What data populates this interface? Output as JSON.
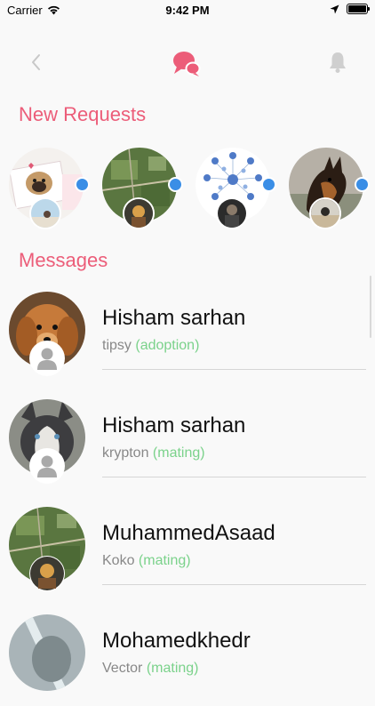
{
  "status_bar": {
    "carrier": "Carrier",
    "time": "9:42 PM"
  },
  "nav": {
    "back_icon": "chevron-left-icon",
    "center_icon": "chat-bubbles-icon",
    "right_icon": "bell-icon",
    "accent": "#ec5d79"
  },
  "sections": {
    "requests_title": "New Requests",
    "messages_title": "Messages"
  },
  "requests": [
    {
      "pet": "pug-collage",
      "unread": true
    },
    {
      "pet": "aerial-map",
      "unread": true
    },
    {
      "pet": "diagram",
      "unread": true
    },
    {
      "pet": "german-shepherd",
      "unread": true
    }
  ],
  "messages": [
    {
      "name": "Hisham sarhan",
      "pet": "tipsy",
      "type": "(adoption)"
    },
    {
      "name": "Hisham sarhan",
      "pet": "krypton",
      "type": "(mating)"
    },
    {
      "name": "MuhammedAsaad",
      "pet": "Koko",
      "type": "(mating)"
    },
    {
      "name": "Mohamedkhedr",
      "pet": "Vector",
      "type": "(mating)"
    }
  ],
  "colors": {
    "accent": "#ec5d79",
    "type_green": "#7bd28b",
    "unread_dot": "#3a8ee6"
  }
}
